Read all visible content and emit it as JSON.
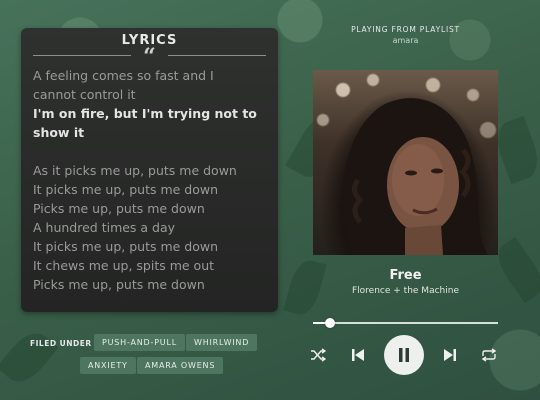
{
  "lyrics": {
    "title": "LYRICS",
    "quote_glyph": "“",
    "lines": [
      {
        "text": "A feeling comes so fast and I",
        "active": false
      },
      {
        "text": "cannot control it",
        "active": false
      },
      {
        "text": "I'm on fire, but I'm trying not to",
        "active": true
      },
      {
        "text": "show it",
        "active": true
      },
      {
        "text": "",
        "active": false
      },
      {
        "text": "As it picks me up, puts me down",
        "active": false
      },
      {
        "text": "It picks me up, puts me down",
        "active": false
      },
      {
        "text": "Picks me up, puts me down",
        "active": false
      },
      {
        "text": "A hundred times a day",
        "active": false
      },
      {
        "text": "It picks me up, puts me down",
        "active": false
      },
      {
        "text": "It chews me up, spits me out",
        "active": false
      },
      {
        "text": "Picks me up, puts me down",
        "active": false
      }
    ]
  },
  "filed_under": {
    "label": "FILED UNDER",
    "tags": [
      "PUSH-AND-PULL",
      "WHIRLWIND",
      "ANXIETY",
      "AMARA OWENS"
    ]
  },
  "player": {
    "playing_from_label": "PLAYING FROM PLAYLIST",
    "playlist_name": "amara",
    "song_title": "Free",
    "artist": "Florence + the Machine",
    "progress": 0.09,
    "controls": {
      "shuffle": "shuffle-icon",
      "previous": "skip-previous-icon",
      "play_pause": "pause-icon",
      "next": "skip-next-icon",
      "repeat": "repeat-icon"
    }
  },
  "colors": {
    "background": "#3a6049",
    "panel": "#2a2b2a",
    "tag": "#4d7560",
    "active_lyric": "#e4e4e4",
    "inactive_lyric": "#9a9a9a"
  }
}
